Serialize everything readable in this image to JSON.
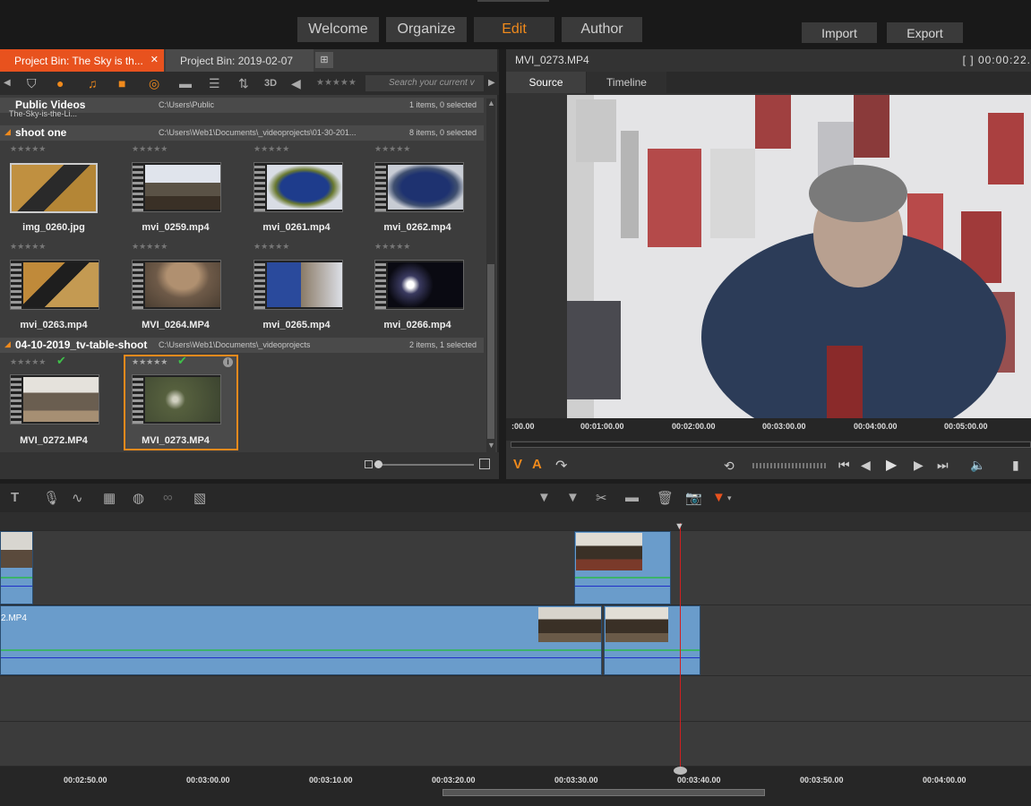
{
  "nav": {
    "tabs": [
      {
        "label": "Welcome"
      },
      {
        "label": "Organize"
      },
      {
        "label": "Edit"
      },
      {
        "label": "Author"
      }
    ],
    "import_label": "Import",
    "export_label": "Export",
    "active_color": "#f08a1c"
  },
  "library": {
    "tabs": [
      {
        "label": "Project Bin: The Sky is th..."
      },
      {
        "label": "Project Bin: 2019-02-07"
      }
    ],
    "search_placeholder": "Search your current v",
    "toolbar_3d": "3D",
    "groups": [
      {
        "name": "Public Videos",
        "path": "C:\\Users\\Public",
        "count": "1 items, 0 selected",
        "sub": "The-Sky-is-the-Li..."
      },
      {
        "name": "shoot one",
        "path": "C:\\Users\\Web1\\Documents\\_videoprojects\\01-30-201...",
        "count": "8 items, 0 selected"
      },
      {
        "name": "04-10-2019_tv-table-shoot",
        "path": "C:\\Users\\Web1\\Documents\\_videoprojects",
        "count": "2 items, 1 selected"
      }
    ],
    "clips": [
      {
        "name": "img_0260.jpg"
      },
      {
        "name": "mvi_0259.mp4"
      },
      {
        "name": "mvi_0261.mp4"
      },
      {
        "name": "mvi_0262.mp4"
      },
      {
        "name": "mvi_0263.mp4"
      },
      {
        "name": "MVI_0264.MP4"
      },
      {
        "name": "mvi_0265.mp4"
      },
      {
        "name": "mvi_0266.mp4"
      },
      {
        "name": "MVI_0272.MP4"
      },
      {
        "name": "MVI_0273.MP4"
      }
    ]
  },
  "preview": {
    "title": "MVI_0273.MP4",
    "timecode": "[ ] 00:00:22.",
    "tabs": [
      {
        "label": "Source"
      },
      {
        "label": "Timeline"
      }
    ],
    "ruler": [
      ":00.00",
      "00:01:00.00",
      "00:02:00.00",
      "00:03:00.00",
      "00:04:00.00",
      "00:05:00.00"
    ],
    "v_label": "V",
    "a_label": "A"
  },
  "timeline": {
    "clip_label": "2.MP4",
    "ruler": [
      "00:02:50.00",
      "00:03:00.00",
      "00:03:10.00",
      "00:03:20.00",
      "00:03:30.00",
      "00:03:40.00",
      "00:03:50.00",
      "00:04:00.00"
    ],
    "playhead_color": "#d02020"
  }
}
